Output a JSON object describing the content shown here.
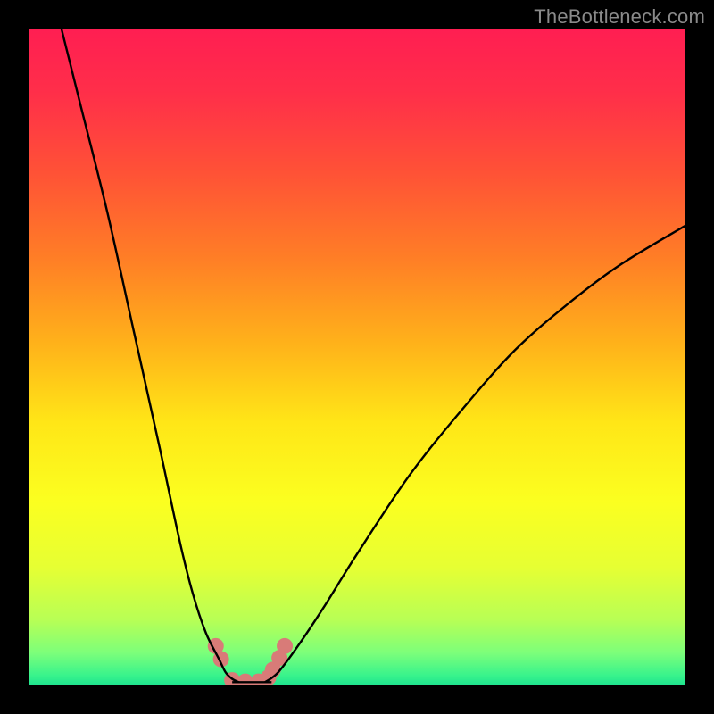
{
  "watermark": "TheBottleneck.com",
  "colors": {
    "gradient_stops": [
      {
        "offset": 0.0,
        "color": "#ff1e52"
      },
      {
        "offset": 0.1,
        "color": "#ff2f49"
      },
      {
        "offset": 0.22,
        "color": "#ff5236"
      },
      {
        "offset": 0.35,
        "color": "#ff7e26"
      },
      {
        "offset": 0.48,
        "color": "#ffb21a"
      },
      {
        "offset": 0.6,
        "color": "#ffe617"
      },
      {
        "offset": 0.72,
        "color": "#fbff20"
      },
      {
        "offset": 0.82,
        "color": "#e6ff33"
      },
      {
        "offset": 0.9,
        "color": "#b8ff55"
      },
      {
        "offset": 0.95,
        "color": "#7dff7a"
      },
      {
        "offset": 0.985,
        "color": "#38f38c"
      },
      {
        "offset": 1.0,
        "color": "#1de28e"
      }
    ],
    "curve": "#000000",
    "markers": "#d87b78",
    "background": "#000000"
  },
  "chart_data": {
    "type": "line",
    "title": "",
    "xlabel": "",
    "ylabel": "",
    "xlim": [
      0,
      100
    ],
    "ylim": [
      0,
      100
    ],
    "series": [
      {
        "name": "bottleneck-curve-left",
        "x": [
          5,
          8,
          12,
          16,
          20,
          23,
          25,
          27,
          29,
          30,
          31,
          32
        ],
        "values": [
          100,
          88,
          72,
          54,
          36,
          22,
          14,
          8,
          4,
          2,
          1,
          0.5
        ]
      },
      {
        "name": "bottleneck-curve-right",
        "x": [
          36,
          38,
          41,
          45,
          50,
          58,
          66,
          74,
          82,
          90,
          100
        ],
        "values": [
          0.5,
          2,
          6,
          12,
          20,
          32,
          42,
          51,
          58,
          64,
          70
        ]
      }
    ],
    "flat_bottom": {
      "x": [
        31,
        37
      ],
      "y": 0.5
    },
    "markers": [
      {
        "x": 28.5,
        "y": 6.0
      },
      {
        "x": 29.3,
        "y": 4.0
      },
      {
        "x": 31.0,
        "y": 0.8
      },
      {
        "x": 33.0,
        "y": 0.6
      },
      {
        "x": 35.0,
        "y": 0.6
      },
      {
        "x": 36.5,
        "y": 1.2
      },
      {
        "x": 37.2,
        "y": 2.4
      },
      {
        "x": 38.2,
        "y": 4.2
      },
      {
        "x": 39.0,
        "y": 6.0
      }
    ]
  }
}
